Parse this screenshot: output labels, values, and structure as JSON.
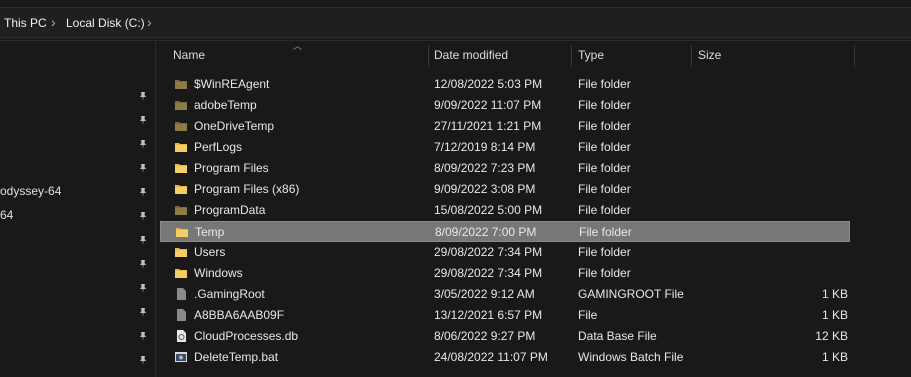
{
  "address": {
    "crumbs": [
      "This PC",
      "Local Disk (C:)"
    ]
  },
  "nav": {
    "items": [
      "odyssey-64",
      "64"
    ]
  },
  "columns": {
    "name": "Name",
    "date": "Date modified",
    "type": "Type",
    "size": "Size"
  },
  "files": [
    {
      "name": "$WinREAgent",
      "date": "12/08/2022 5:03 PM",
      "type": "File folder",
      "size": "",
      "icon": "folder-dark-icon"
    },
    {
      "name": "adobeTemp",
      "date": "9/09/2022 11:07 PM",
      "type": "File folder",
      "size": "",
      "icon": "folder-dark-icon"
    },
    {
      "name": "OneDriveTemp",
      "date": "27/11/2021 1:21 PM",
      "type": "File folder",
      "size": "",
      "icon": "folder-dark-icon"
    },
    {
      "name": "PerfLogs",
      "date": "7/12/2019 8:14 PM",
      "type": "File folder",
      "size": "",
      "icon": "folder-icon"
    },
    {
      "name": "Program Files",
      "date": "8/09/2022 7:23 PM",
      "type": "File folder",
      "size": "",
      "icon": "folder-icon"
    },
    {
      "name": "Program Files (x86)",
      "date": "9/09/2022 3:08 PM",
      "type": "File folder",
      "size": "",
      "icon": "folder-icon"
    },
    {
      "name": "ProgramData",
      "date": "15/08/2022 5:00 PM",
      "type": "File folder",
      "size": "",
      "icon": "folder-dark-icon"
    },
    {
      "name": "Temp",
      "date": "8/09/2022 7:00 PM",
      "type": "File folder",
      "size": "",
      "icon": "folder-icon",
      "selected": true
    },
    {
      "name": "Users",
      "date": "29/08/2022 7:34 PM",
      "type": "File folder",
      "size": "",
      "icon": "folder-icon"
    },
    {
      "name": "Windows",
      "date": "29/08/2022 7:34 PM",
      "type": "File folder",
      "size": "",
      "icon": "folder-icon"
    },
    {
      "name": ".GamingRoot",
      "date": "3/05/2022 9:12 AM",
      "type": "GAMINGROOT File",
      "size": "1 KB",
      "icon": "file-dark-icon"
    },
    {
      "name": "A8BBA6AAB09F",
      "date": "13/12/2021 6:57 PM",
      "type": "File",
      "size": "1 KB",
      "icon": "file-dark-icon"
    },
    {
      "name": "CloudProcesses.db",
      "date": "8/06/2022 9:27 PM",
      "type": "Data Base File",
      "size": "12 KB",
      "icon": "database-file-icon"
    },
    {
      "name": "DeleteTemp.bat",
      "date": "24/08/2022 11:07 PM",
      "type": "Windows Batch File",
      "size": "1 KB",
      "icon": "batch-file-icon"
    }
  ]
}
